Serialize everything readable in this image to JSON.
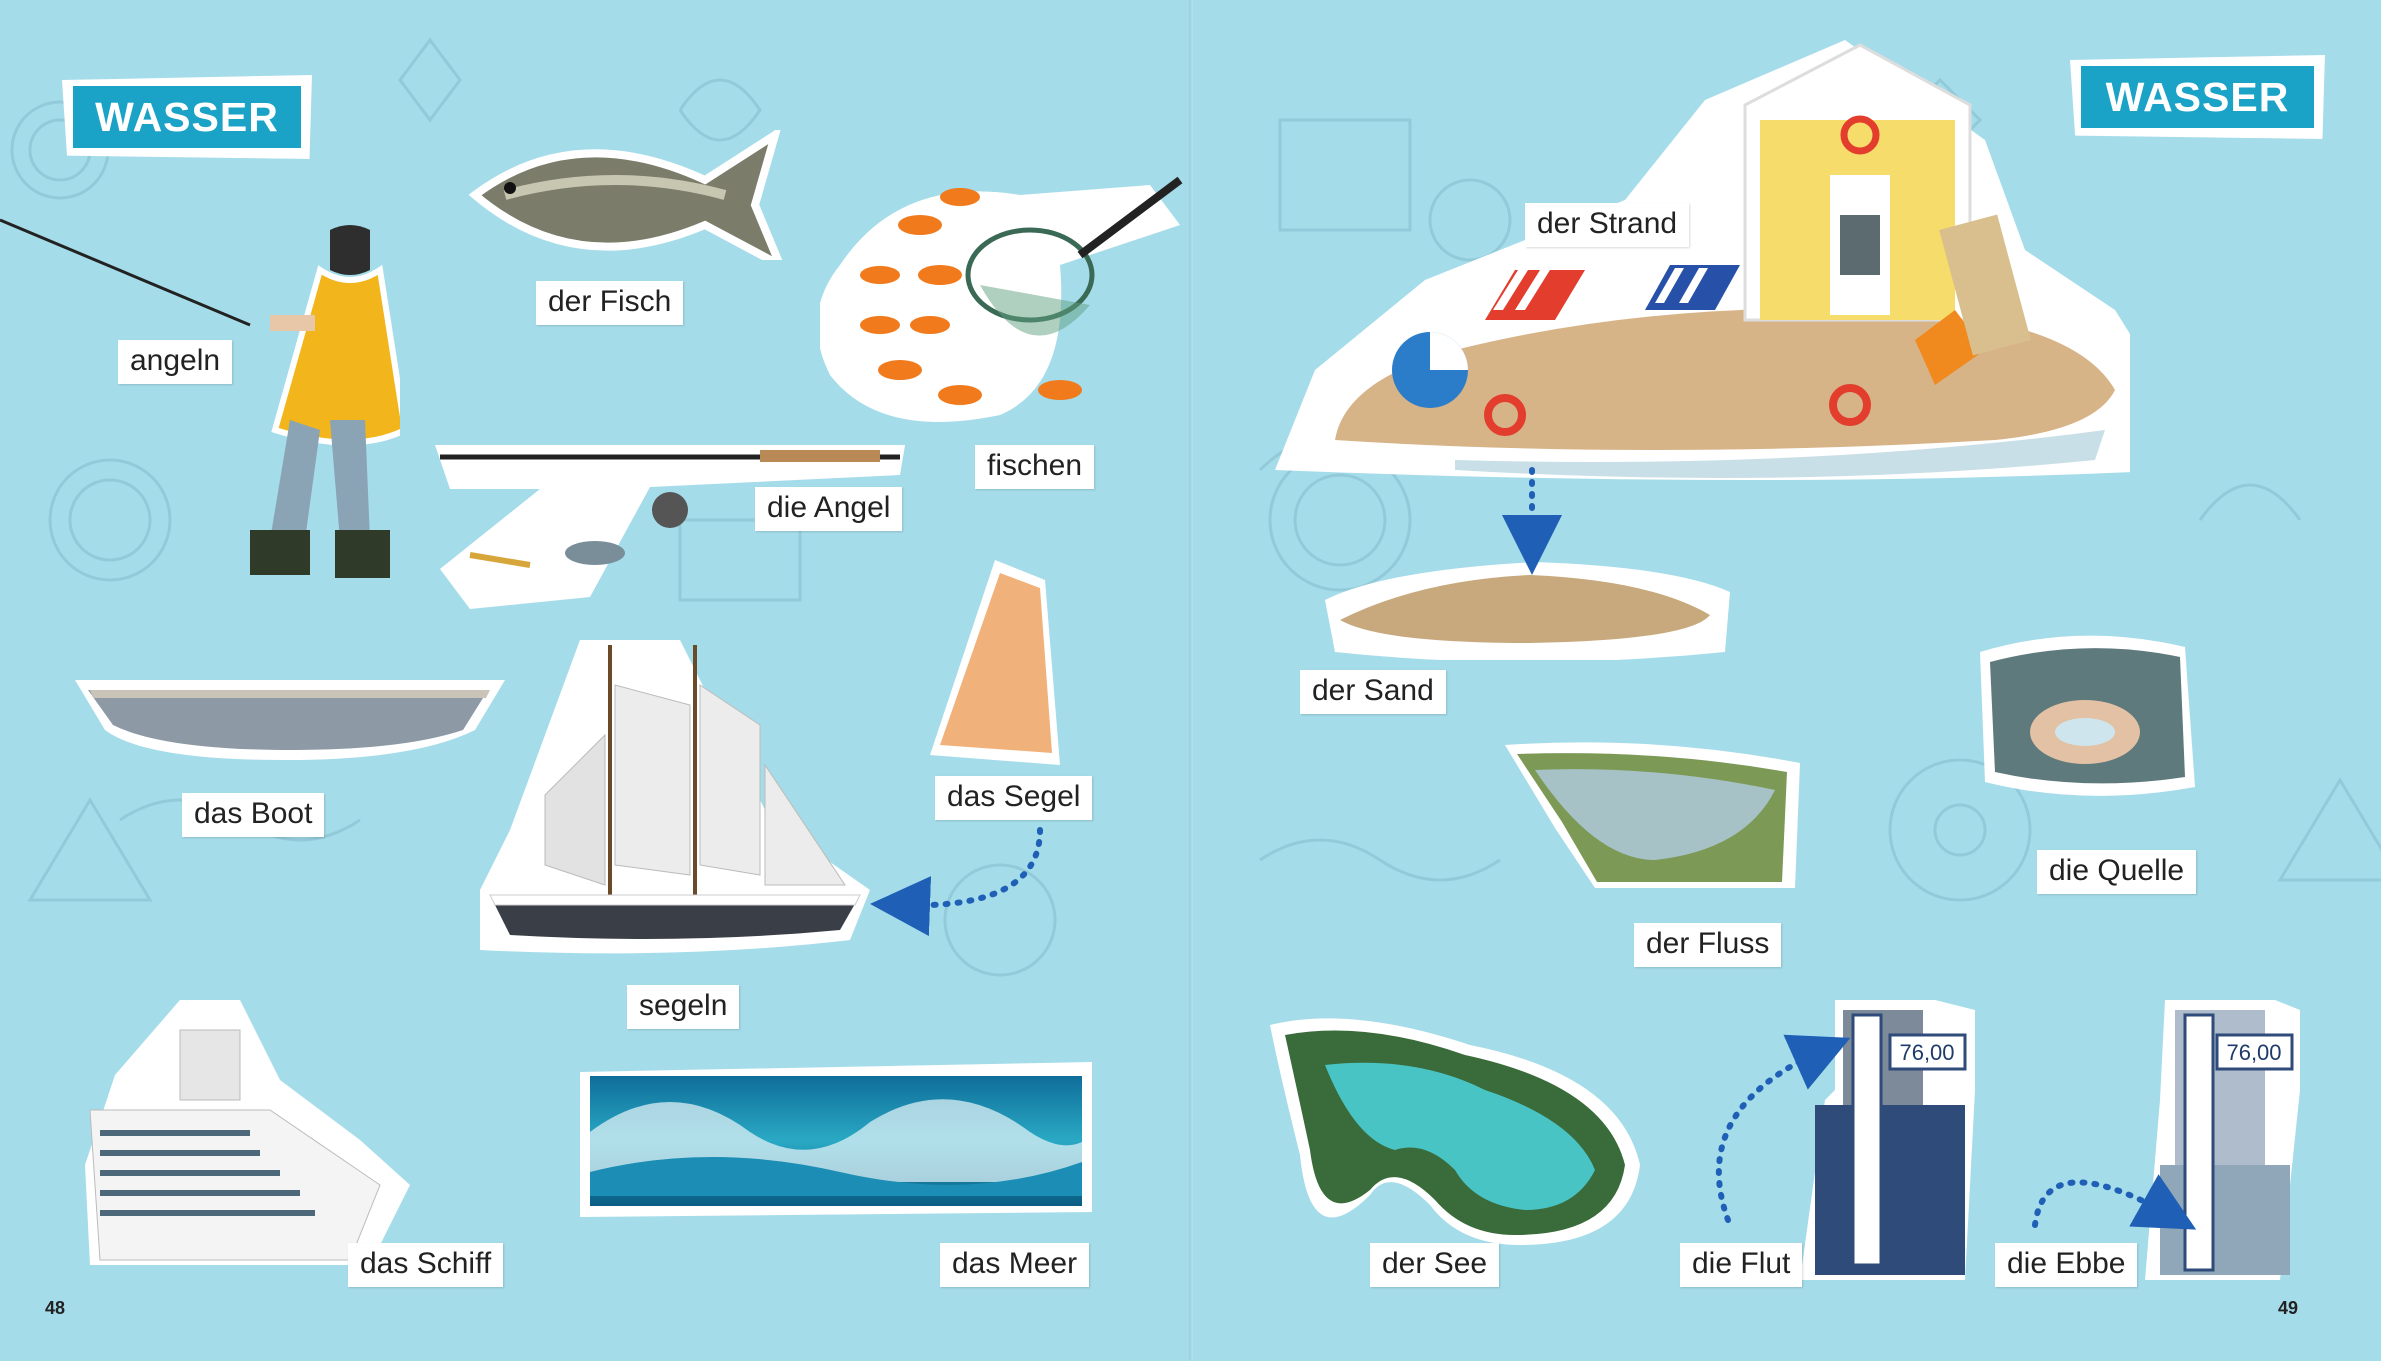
{
  "left_page": {
    "title": "WASSER",
    "page_number": "48",
    "labels": {
      "angeln": "angeln",
      "fish": "der Fisch",
      "fishing": "fischen",
      "rod": "die Angel",
      "boat": "das Boot",
      "sail": "das Segel",
      "sailing": "segeln",
      "ship": "das Schiff",
      "sea": "das Meer"
    }
  },
  "right_page": {
    "title": "WASSER",
    "page_number": "49",
    "labels": {
      "beach": "der Strand",
      "sand": "der Sand",
      "spring": "die Quelle",
      "river": "der Fluss",
      "lake": "der See",
      "high_tide": "die Flut",
      "low_tide": "die Ebbe"
    },
    "gauge_reading": "76,00"
  },
  "colors": {
    "background": "#a5dcea",
    "title_fill": "#1aa2c7",
    "arrow": "#1f5fb5"
  }
}
